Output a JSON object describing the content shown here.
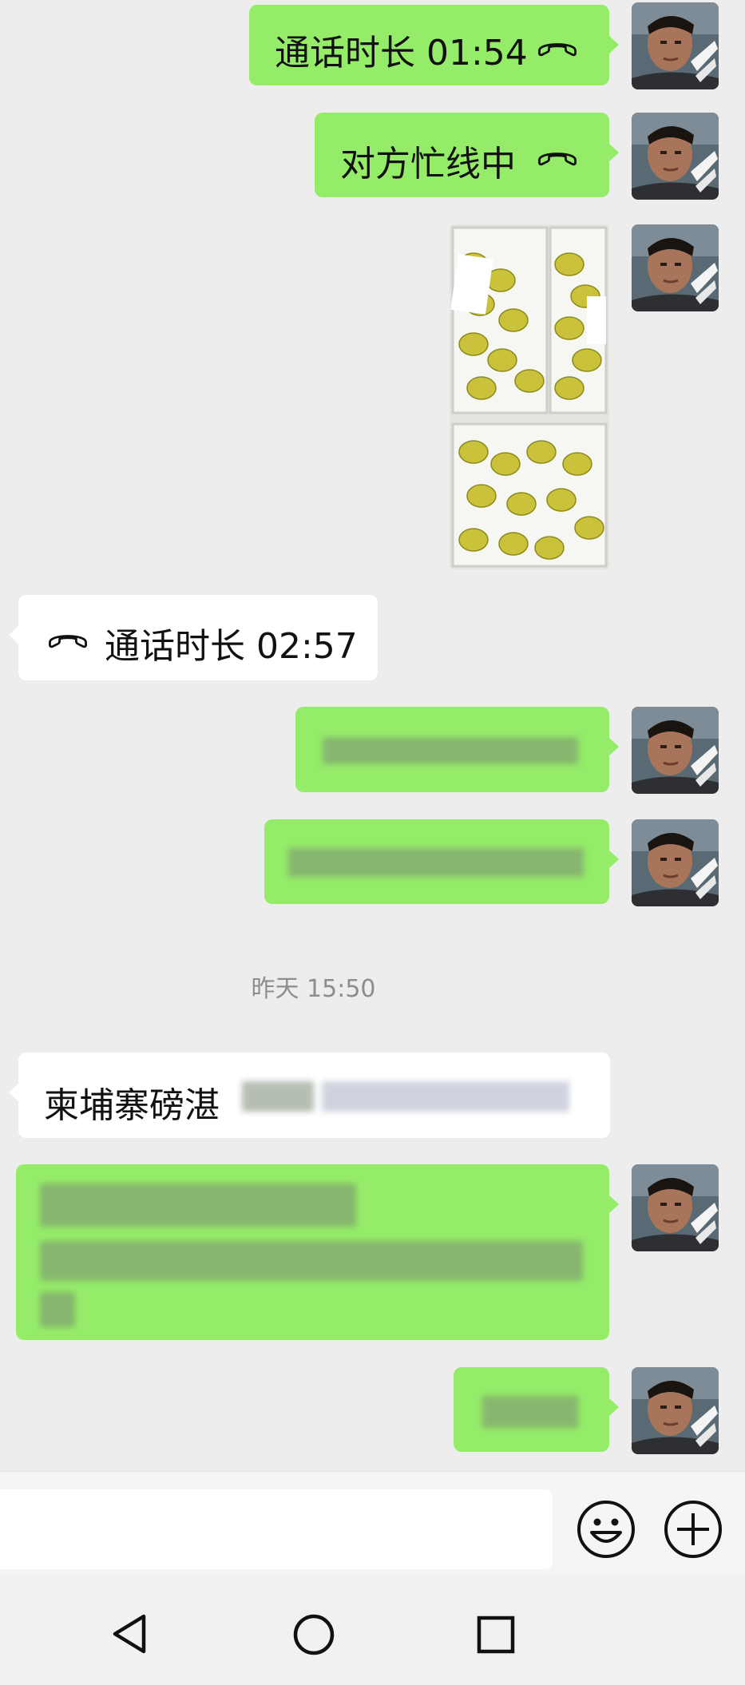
{
  "messages": {
    "call_duration_1": "通话时长 01:54",
    "busy": "对方忙线中",
    "call_duration_2": "通话时长 02:57",
    "timestamp": "昨天 15:50",
    "incoming_text": "柬埔寨磅湛"
  },
  "icons": {
    "phone": "phone-hangup-icon",
    "emoji": "emoji-icon",
    "plus": "plus-icon",
    "nav_back": "nav-back-icon",
    "nav_home": "nav-home-icon",
    "nav_recents": "nav-recents-icon"
  },
  "colors": {
    "outgoing_bubble": "#95ec69",
    "incoming_bubble": "#ffffff",
    "background": "#ededed"
  }
}
